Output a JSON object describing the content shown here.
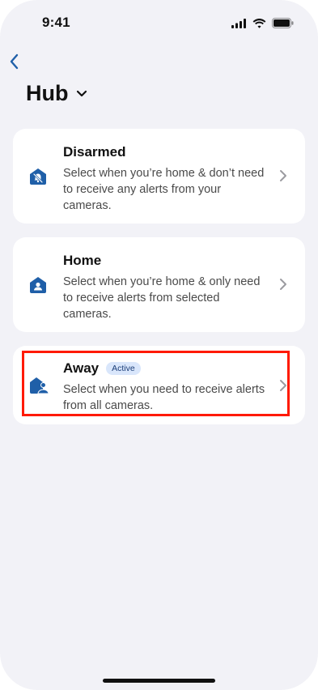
{
  "status_bar": {
    "time": "9:41"
  },
  "header": {
    "title": "Hub"
  },
  "modes": [
    {
      "title": "Disarmed",
      "description": "Select when you’re home & don’t need to receive any alerts from your cameras.",
      "icon": "bell-off-icon"
    },
    {
      "title": "Home",
      "description": "Select when you’re home & only need to receive alerts from selected cameras.",
      "icon": "home-person-icon"
    },
    {
      "title": "Away",
      "badge": "Active",
      "description": "Select when you need to receive alerts from all cameras.",
      "icon": "away-person-icon"
    }
  ],
  "colors": {
    "accent": "#1f5fa8",
    "highlight": "#ff1a00",
    "badge_bg": "#d9e6fb",
    "background": "#f2f2f7"
  }
}
